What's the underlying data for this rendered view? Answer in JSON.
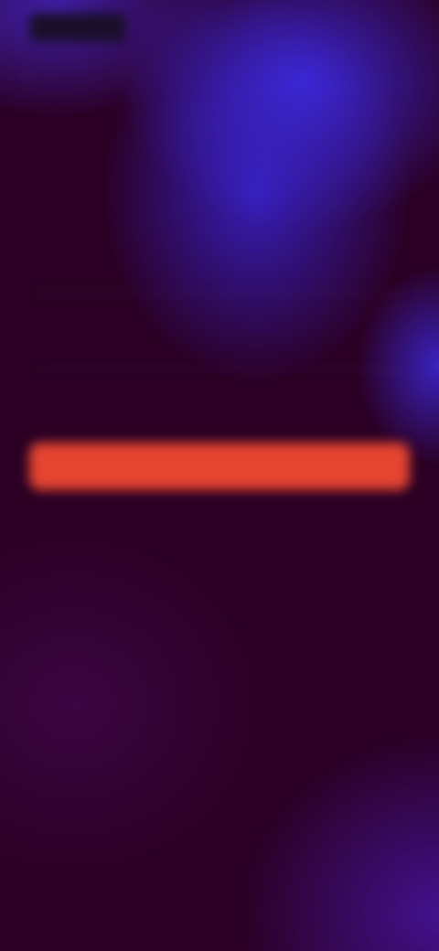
{
  "app": {
    "logo_text": "",
    "title": "",
    "subtitle": ""
  },
  "form": {
    "email_label": "",
    "email_value": "",
    "password_label": "",
    "password_value": "",
    "submit_label": "",
    "secondary_link": ""
  },
  "footer": {
    "text": "",
    "link": ""
  },
  "colors": {
    "background": "#2b0024",
    "accent_blue": "#3c28dc",
    "primary_button": "#e44430",
    "title_text": "#d4c8f6"
  },
  "icons": {
    "back": "chevron-left-icon"
  }
}
